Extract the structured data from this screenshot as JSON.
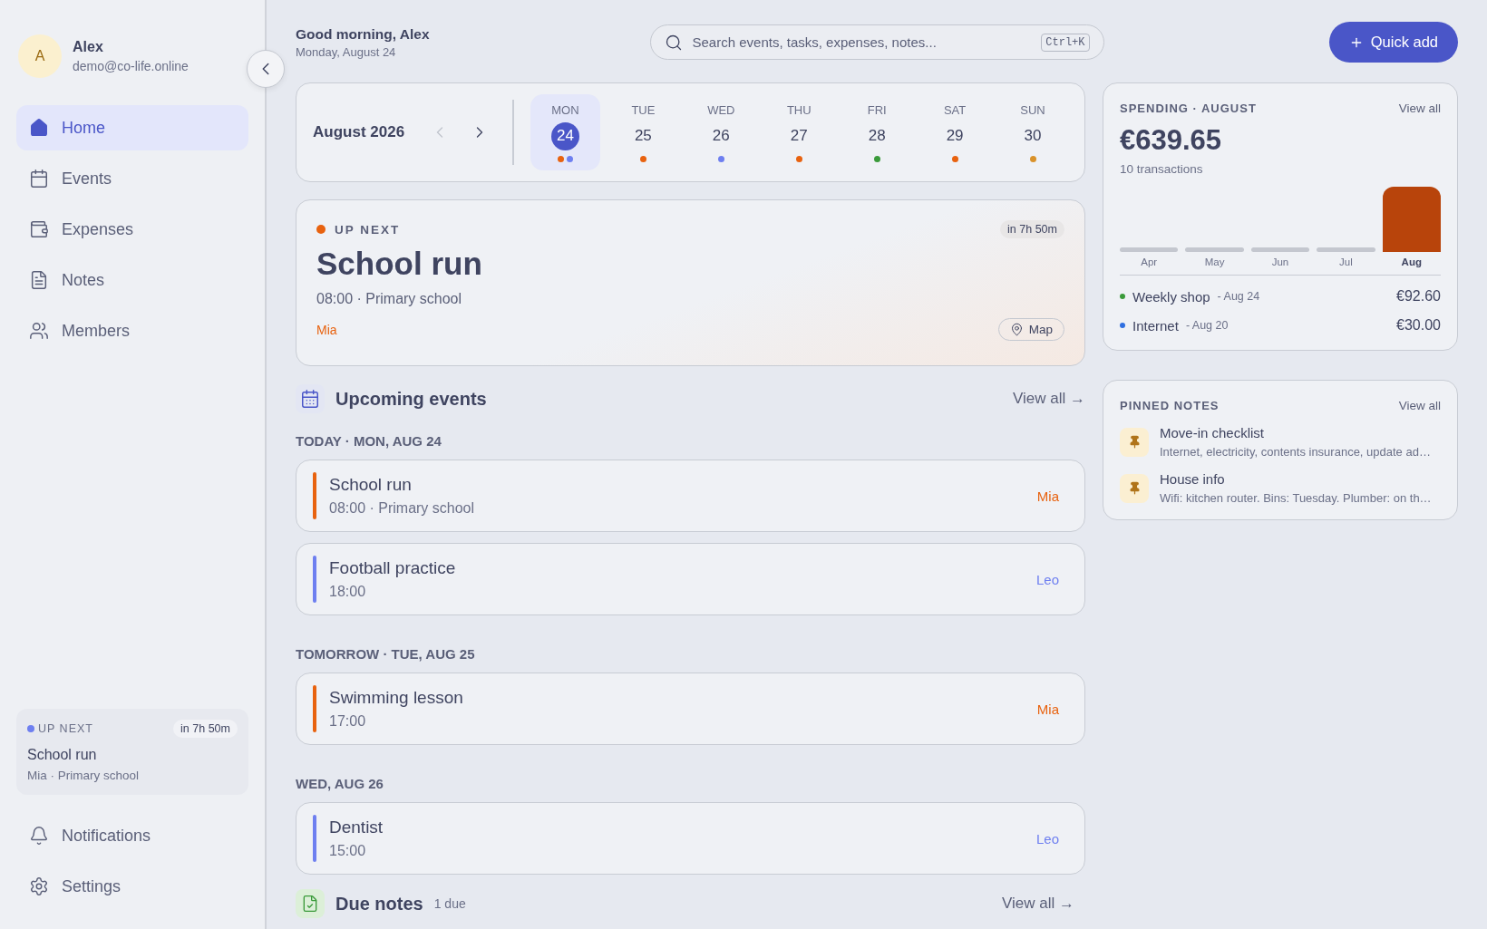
{
  "sidebar": {
    "user": {
      "initial": "A",
      "name": "Alex",
      "email": "demo@co-life.online"
    },
    "nav": [
      {
        "label": "Home",
        "selected": true
      },
      {
        "label": "Events",
        "selected": false
      },
      {
        "label": "Expenses",
        "selected": false
      },
      {
        "label": "Notes",
        "selected": false
      },
      {
        "label": "Members",
        "selected": false
      }
    ],
    "up_next": {
      "label": "UP NEXT",
      "countdown": "in 7h 50m",
      "title": "School run",
      "detail": "Mia · Primary school"
    },
    "footer": [
      {
        "label": "Notifications"
      },
      {
        "label": "Settings"
      }
    ]
  },
  "header": {
    "greeting": "Good morning, Alex",
    "date": "Monday, August 24",
    "search": {
      "placeholder": "Search events, tasks, expenses, notes...",
      "shortcut": "Ctrl+K"
    },
    "quick_add": "Quick add"
  },
  "week": {
    "month": "August 2026",
    "days": [
      {
        "weekday": "MON",
        "date": "24",
        "selected": true,
        "dots": [
          {
            "color": "#e8620f"
          },
          {
            "color": "#6e7ff0"
          }
        ]
      },
      {
        "weekday": "TUE",
        "date": "25",
        "selected": false,
        "dots": [
          {
            "color": "#e8620f"
          }
        ]
      },
      {
        "weekday": "WED",
        "date": "26",
        "selected": false,
        "dots": [
          {
            "color": "#6e7ff0"
          }
        ]
      },
      {
        "weekday": "THU",
        "date": "27",
        "selected": false,
        "dots": [
          {
            "color": "#e8620f"
          }
        ]
      },
      {
        "weekday": "FRI",
        "date": "28",
        "selected": false,
        "dots": [
          {
            "color": "#3a9a3a"
          }
        ]
      },
      {
        "weekday": "SAT",
        "date": "29",
        "selected": false,
        "dots": [
          {
            "color": "#e8620f"
          }
        ]
      },
      {
        "weekday": "SUN",
        "date": "30",
        "selected": false,
        "dots": [
          {
            "color": "#d9922a"
          }
        ]
      }
    ]
  },
  "up_next": {
    "label": "UP NEXT",
    "countdown": "in 7h 50m",
    "title": "School run",
    "detail": "08:00 · Primary school",
    "member": "Mia",
    "color": "#e8620f",
    "map": "Map"
  },
  "upcoming": {
    "title": "Upcoming events",
    "view_all": "View all →",
    "groups": [
      {
        "label": "TODAY · MON, AUG 24",
        "events": [
          {
            "title": "School run",
            "detail": "08:00 · Primary school",
            "member": "Mia",
            "color": "#e8620f"
          },
          {
            "title": "Football practice",
            "detail": "18:00",
            "member": "Leo",
            "color": "#6e7ff0"
          }
        ]
      },
      {
        "label": "TOMORROW · TUE, AUG 25",
        "events": [
          {
            "title": "Swimming lesson",
            "detail": "17:00",
            "member": "Mia",
            "color": "#e8620f"
          }
        ]
      },
      {
        "label": "WED, AUG 26",
        "events": [
          {
            "title": "Dentist",
            "detail": "15:00",
            "member": "Leo",
            "color": "#6e7ff0"
          }
        ]
      }
    ]
  },
  "due_notes": {
    "title": "Due notes",
    "count": "1 due",
    "view_all": "View all →"
  },
  "spending": {
    "title": "SPENDING · AUGUST",
    "view_all": "View all",
    "total": "€639.65",
    "count": "10 transactions",
    "months": [
      {
        "label": "Apr",
        "selected": false
      },
      {
        "label": "May",
        "selected": false
      },
      {
        "label": "Jun",
        "selected": false
      },
      {
        "label": "Jul",
        "selected": false
      },
      {
        "label": "Aug",
        "selected": true
      }
    ],
    "transactions": [
      {
        "name": "Weekly shop",
        "date": "- Aug 24",
        "amount": "€92.60",
        "color": "#3a9a3a"
      },
      {
        "name": "Internet",
        "date": "- Aug 20",
        "amount": "€30.00",
        "color": "#2f6fe0"
      }
    ]
  },
  "pinned_notes": {
    "title": "PINNED NOTES",
    "view_all": "View all",
    "notes": [
      {
        "title": "Move-in checklist",
        "preview": "Internet, electricity, contents insurance, update ad…"
      },
      {
        "title": "House info",
        "preview": "Wifi: kitchen router. Bins: Tuesday. Plumber: on th…"
      }
    ]
  }
}
